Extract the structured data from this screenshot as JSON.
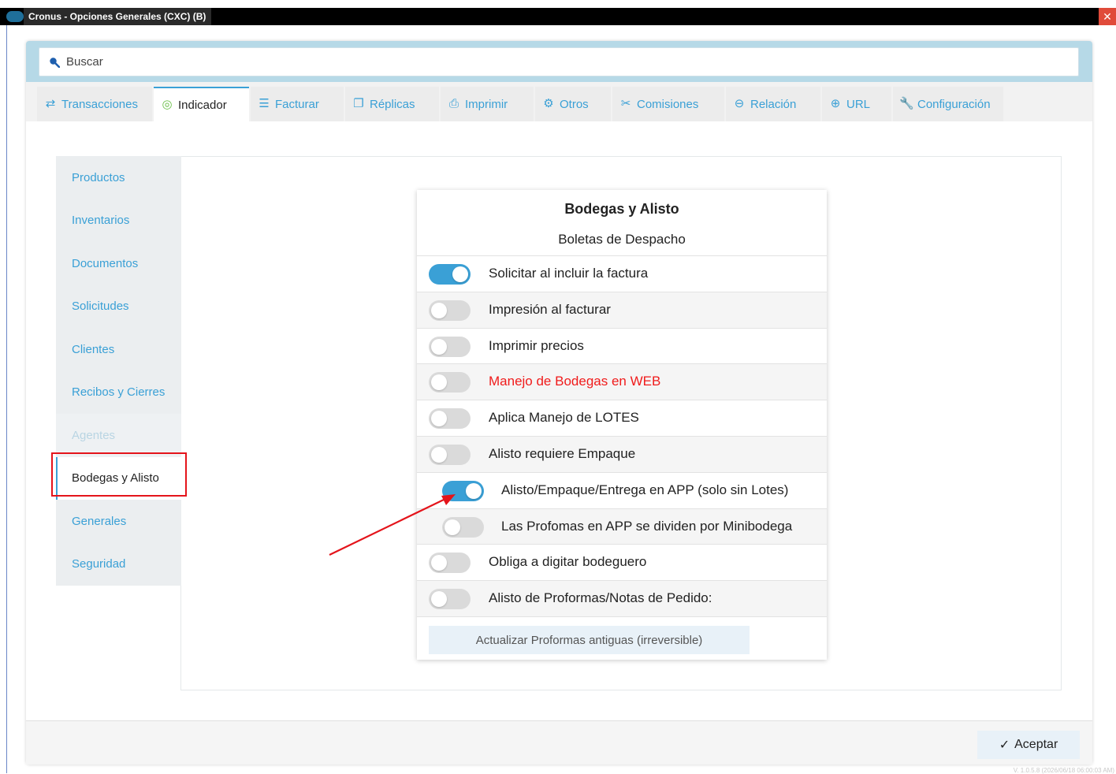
{
  "window": {
    "title": "Cronus - Opciones Generales (CXC) (B)"
  },
  "search": {
    "placeholder": "Buscar"
  },
  "tabs": [
    {
      "label": "Transacciones",
      "icon": "arrows-swap-icon",
      "glyph": "⇄"
    },
    {
      "label": "Indicador",
      "icon": "power-indicator-icon",
      "glyph": "◎",
      "active": true
    },
    {
      "label": "Facturar",
      "icon": "document-list-icon",
      "glyph": "☰"
    },
    {
      "label": "Réplicas",
      "icon": "copy-icon",
      "glyph": "❐"
    },
    {
      "label": "Imprimir",
      "icon": "printer-icon",
      "glyph": "⎙"
    },
    {
      "label": "Otros",
      "icon": "gears-icon",
      "glyph": "⚙"
    },
    {
      "label": "Comisiones",
      "icon": "commission-icon",
      "glyph": "✂"
    },
    {
      "label": "Relación",
      "icon": "link-icon",
      "glyph": "⊖"
    },
    {
      "label": "URL",
      "icon": "globe-icon",
      "glyph": "⊕"
    },
    {
      "label": "Configuración",
      "icon": "wrench-icon",
      "glyph": "🔧"
    }
  ],
  "sidenav": [
    {
      "label": "Productos"
    },
    {
      "label": "Inventarios"
    },
    {
      "label": "Documentos"
    },
    {
      "label": "Solicitudes"
    },
    {
      "label": "Clientes"
    },
    {
      "label": "Recibos y Cierres"
    },
    {
      "label": "Agentes",
      "muted": true
    },
    {
      "label": "Bodegas y Alisto",
      "selected": true
    },
    {
      "label": "Generales"
    },
    {
      "label": "Seguridad"
    }
  ],
  "card": {
    "title": "Bodegas y Alisto",
    "subtitle": "Boletas de Despacho",
    "options": [
      {
        "label": "Solicitar al incluir la factura",
        "on": true
      },
      {
        "label": "Impresión al facturar",
        "on": false
      },
      {
        "label": "Imprimir precios",
        "on": false
      },
      {
        "label": "Manejo de Bodegas en WEB",
        "on": false,
        "red": true
      },
      {
        "label": "Aplica Manejo de LOTES",
        "on": false
      },
      {
        "label": "Alisto requiere Empaque",
        "on": false
      },
      {
        "label": "Alisto/Empaque/Entrega en APP (solo sin Lotes)",
        "on": true,
        "indent": true
      },
      {
        "label": "Las Profomas en APP se dividen por Minibodega",
        "on": false,
        "indent": true
      },
      {
        "label": "Obliga a digitar bodeguero",
        "on": false
      },
      {
        "label": "Alisto de Proformas/Notas de Pedido:",
        "on": false
      }
    ],
    "update_button": "Actualizar Proformas antiguas (irreversible)"
  },
  "footer": {
    "accept_label": "Aceptar",
    "version": "V. 1.0.5.8 (2026/06/18 06:00:03 AM)"
  },
  "colors": {
    "accent": "#3aa0d6",
    "highlight": "#e4141b"
  }
}
